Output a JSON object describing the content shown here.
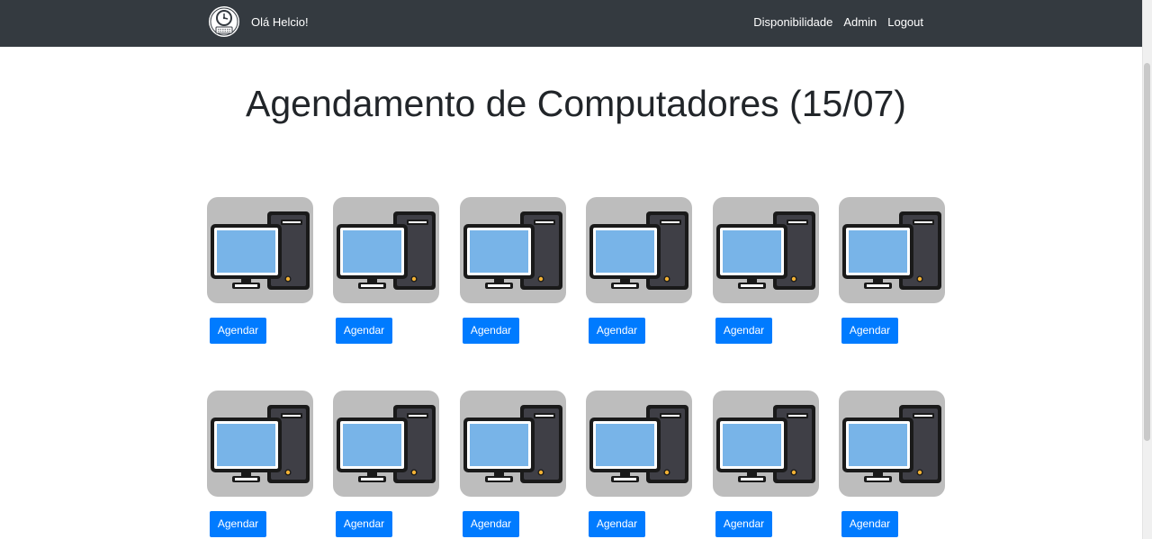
{
  "navbar": {
    "greeting": "Olá Helcio!",
    "links": [
      "Disponibilidade",
      "Admin",
      "Logout"
    ],
    "background": "#343a40"
  },
  "header": {
    "title": "Agendamento de Computadores (15/07)"
  },
  "computers": [
    {
      "icon": "computer-icon",
      "button_label": "Agendar"
    },
    {
      "icon": "computer-icon",
      "button_label": "Agendar"
    },
    {
      "icon": "computer-icon",
      "button_label": "Agendar"
    },
    {
      "icon": "computer-icon",
      "button_label": "Agendar"
    },
    {
      "icon": "computer-icon",
      "button_label": "Agendar"
    },
    {
      "icon": "computer-icon",
      "button_label": "Agendar"
    },
    {
      "icon": "computer-icon",
      "button_label": "Agendar"
    },
    {
      "icon": "computer-icon",
      "button_label": "Agendar"
    },
    {
      "icon": "computer-icon",
      "button_label": "Agendar"
    },
    {
      "icon": "computer-icon",
      "button_label": "Agendar"
    },
    {
      "icon": "computer-icon",
      "button_label": "Agendar"
    },
    {
      "icon": "computer-icon",
      "button_label": "Agendar"
    }
  ],
  "colors": {
    "button": "#007bff",
    "tile": "#bdbdbd",
    "screen": "#78b4e8",
    "tower": "#3f3f46"
  }
}
